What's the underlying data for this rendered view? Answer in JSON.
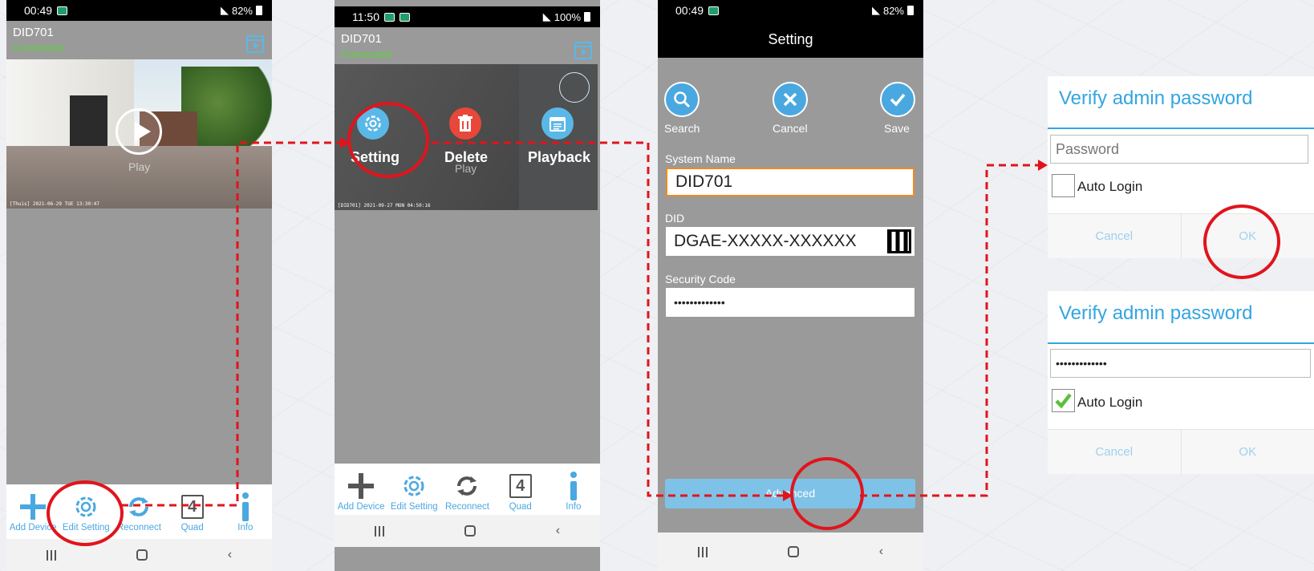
{
  "status_time_1": "00:49",
  "status_time_2": "11:50",
  "status_time_3": "00:49",
  "status_right_1": "82%",
  "status_right_2": "100%",
  "status_right_3": "82%",
  "device": {
    "name": "DID701",
    "status": "Connected"
  },
  "video": {
    "play_label": "Play",
    "caption_1": "[Thuis] 2021-06-29 TUE 13:30:47",
    "caption_2": "[DID701] 2021-09-27 MON 04:50:16"
  },
  "toolbar": {
    "add_device": "Add Device",
    "edit_setting": "Edit Setting",
    "reconnect": "Reconnect",
    "quad": "Quad",
    "quad_number": "4",
    "info": "Info"
  },
  "actions": {
    "setting": "Setting",
    "delete": "Delete",
    "playback": "Playback"
  },
  "settings": {
    "title": "Setting",
    "search": "Search",
    "cancel": "Cancel",
    "save": "Save",
    "system_name_label": "System Name",
    "system_name_value": "DID701",
    "did_label": "DID",
    "did_value": "DGAE-XXXXX-XXXXXX",
    "security_label": "Security Code",
    "security_value": "•••••••••••••",
    "advanced": "Advanced"
  },
  "dialog1": {
    "title": "Verify admin password",
    "placeholder": "Password",
    "auto_login": "Auto Login",
    "cancel": "Cancel",
    "ok": "OK"
  },
  "dialog2": {
    "title": "Verify admin password",
    "password_value": "•••••••••••••",
    "auto_login": "Auto Login",
    "cancel": "Cancel",
    "ok": "OK"
  },
  "colors": {
    "accent": "#4aa8e0",
    "dialog_blue": "#33a5e0",
    "connected_green": "#5bd33a",
    "annotation_red": "#e1141c",
    "focus_orange": "#f08a1c"
  }
}
